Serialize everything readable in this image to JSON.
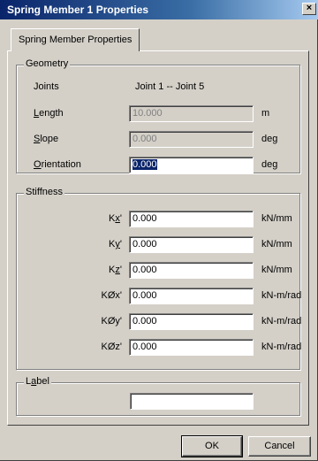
{
  "window": {
    "title": "Spring Member 1 Properties",
    "close_glyph": "×"
  },
  "tab": {
    "label": "Spring Member Properties"
  },
  "geometry": {
    "group_label": "Geometry",
    "joints_label": "Joints",
    "joints_value": "Joint 1  --  Joint 5",
    "length": {
      "label_pre": "",
      "label_ul": "L",
      "label_post": "ength",
      "value": "10.000",
      "unit": "m"
    },
    "slope": {
      "label_pre": "",
      "label_ul": "S",
      "label_post": "lope",
      "value": "0.000",
      "unit": "deg"
    },
    "orientation": {
      "label_pre": "",
      "label_ul": "O",
      "label_post": "rientation",
      "value": "0.000",
      "unit": "deg"
    }
  },
  "stiffness": {
    "group_label": "Stiffness",
    "rows": [
      {
        "label_pre": "K",
        "label_ul": "x",
        "label_post": "'",
        "value": "0.000",
        "unit": "kN/mm"
      },
      {
        "label_pre": "K",
        "label_ul": "y",
        "label_post": "'",
        "value": "0.000",
        "unit": "kN/mm"
      },
      {
        "label_pre": "K",
        "label_ul": "z",
        "label_post": "'",
        "value": "0.000",
        "unit": "kN/mm"
      },
      {
        "label_pre": "KØx'",
        "label_ul": "",
        "label_post": "",
        "value": "0.000",
        "unit": "kN-m/rad"
      },
      {
        "label_pre": "KØy'",
        "label_ul": "",
        "label_post": "",
        "value": "0.000",
        "unit": "kN-m/rad"
      },
      {
        "label_pre": "KØz'",
        "label_ul": "",
        "label_post": "",
        "value": "0.000",
        "unit": "kN-m/rad"
      }
    ]
  },
  "label_group": {
    "label_pre": "L",
    "label_ul": "a",
    "label_post": "bel",
    "value": ""
  },
  "buttons": {
    "ok": "OK",
    "cancel": "Cancel"
  }
}
